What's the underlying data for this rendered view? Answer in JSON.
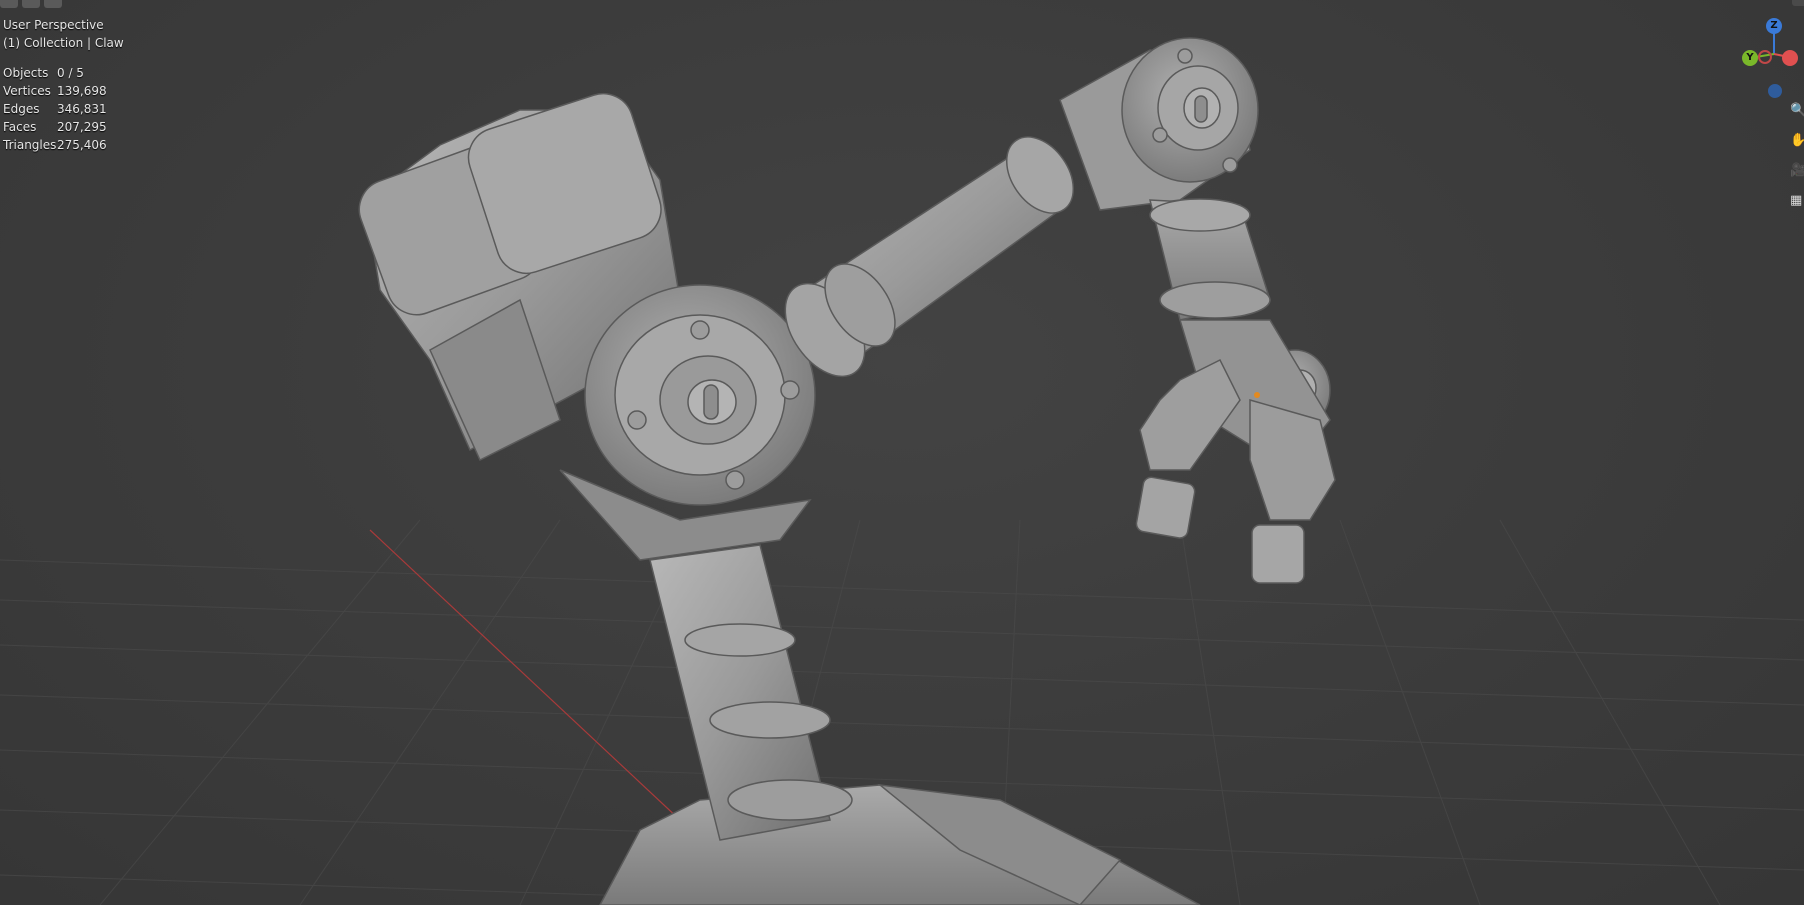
{
  "viewport": {
    "view_name": "User Perspective",
    "collection": "(1) Collection | Claw"
  },
  "stats": [
    {
      "label": "Objects",
      "value": "0 / 5"
    },
    {
      "label": "Vertices",
      "value": "139,698"
    },
    {
      "label": "Edges",
      "value": "346,831"
    },
    {
      "label": "Faces",
      "value": "207,295"
    },
    {
      "label": "Triangles",
      "value": "275,406"
    }
  ],
  "gizmo": {
    "z": "Z",
    "y": "Y",
    "x_color": "#e05050",
    "y_color": "#7ab82a",
    "z_color": "#3a7ad8"
  },
  "tools": [
    "zoom-icon",
    "hand-icon",
    "camera-icon",
    "grid-icon"
  ],
  "colors": {
    "background": "#3d3d3d",
    "model": "#9a9a9a",
    "x_axis_line": "#a83a3a"
  }
}
